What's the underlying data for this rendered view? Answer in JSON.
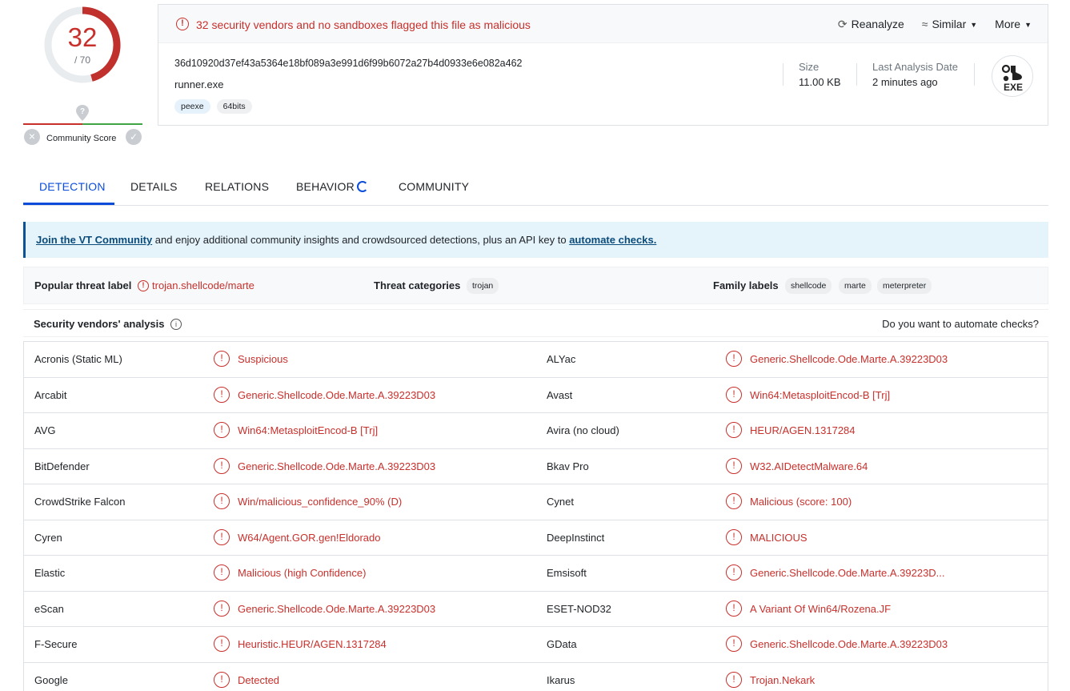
{
  "score": {
    "detections": "32",
    "total": "/ 70"
  },
  "community": {
    "label": "Community Score"
  },
  "alert": {
    "text": "32 security vendors and no sandboxes flagged this file as malicious"
  },
  "actions": {
    "reanalyze": "Reanalyze",
    "similar": "Similar",
    "more": "More"
  },
  "file": {
    "hash": "36d10920d37ef43a5364e18bf089a3e991d6f99b6072a27b4d0933e6e082a462",
    "name": "runner.exe",
    "tags": [
      "peexe",
      "64bits"
    ],
    "size_label": "Size",
    "size_value": "11.00 KB",
    "date_label": "Last Analysis Date",
    "date_value": "2 minutes ago",
    "type_badge": "EXE"
  },
  "tabs": [
    "DETECTION",
    "DETAILS",
    "RELATIONS",
    "BEHAVIOR",
    "COMMUNITY"
  ],
  "banner": {
    "link1": "Join the VT Community",
    "middle": " and enjoy additional community insights and crowdsourced detections, plus an API key to ",
    "link2": "automate checks."
  },
  "labels": {
    "popular_title": "Popular threat label",
    "popular_value": "trojan.shellcode/marte",
    "categories_title": "Threat categories",
    "categories": [
      "trojan"
    ],
    "family_title": "Family labels",
    "families": [
      "shellcode",
      "marte",
      "meterpreter"
    ]
  },
  "vendors_header": {
    "title": "Security vendors' analysis",
    "right": "Do you want to automate checks?"
  },
  "vendors": [
    {
      "left_name": "Acronis (Static ML)",
      "left_result": "Suspicious",
      "right_name": "ALYac",
      "right_result": "Generic.Shellcode.Ode.Marte.A.39223D03"
    },
    {
      "left_name": "Arcabit",
      "left_result": "Generic.Shellcode.Ode.Marte.A.39223D03",
      "right_name": "Avast",
      "right_result": "Win64:MetasploitEncod-B [Trj]"
    },
    {
      "left_name": "AVG",
      "left_result": "Win64:MetasploitEncod-B [Trj]",
      "right_name": "Avira (no cloud)",
      "right_result": "HEUR/AGEN.1317284"
    },
    {
      "left_name": "BitDefender",
      "left_result": "Generic.Shellcode.Ode.Marte.A.39223D03",
      "right_name": "Bkav Pro",
      "right_result": "W32.AIDetectMalware.64"
    },
    {
      "left_name": "CrowdStrike Falcon",
      "left_result": "Win/malicious_confidence_90% (D)",
      "right_name": "Cynet",
      "right_result": "Malicious (score: 100)"
    },
    {
      "left_name": "Cyren",
      "left_result": "W64/Agent.GOR.gen!Eldorado",
      "right_name": "DeepInstinct",
      "right_result": "MALICIOUS"
    },
    {
      "left_name": "Elastic",
      "left_result": "Malicious (high Confidence)",
      "right_name": "Emsisoft",
      "right_result": "Generic.Shellcode.Ode.Marte.A.39223D..."
    },
    {
      "left_name": "eScan",
      "left_result": "Generic.Shellcode.Ode.Marte.A.39223D03",
      "right_name": "ESET-NOD32",
      "right_result": "A Variant Of Win64/Rozena.JF"
    },
    {
      "left_name": "F-Secure",
      "left_result": "Heuristic.HEUR/AGEN.1317284",
      "right_name": "GData",
      "right_result": "Generic.Shellcode.Ode.Marte.A.39223D03"
    },
    {
      "left_name": "Google",
      "left_result": "Detected",
      "right_name": "Ikarus",
      "right_result": "Trojan.Nekark"
    }
  ],
  "colors": {
    "malicious": "#c8302c",
    "accent": "#0b4dda",
    "banner": "#e5f3fb"
  }
}
